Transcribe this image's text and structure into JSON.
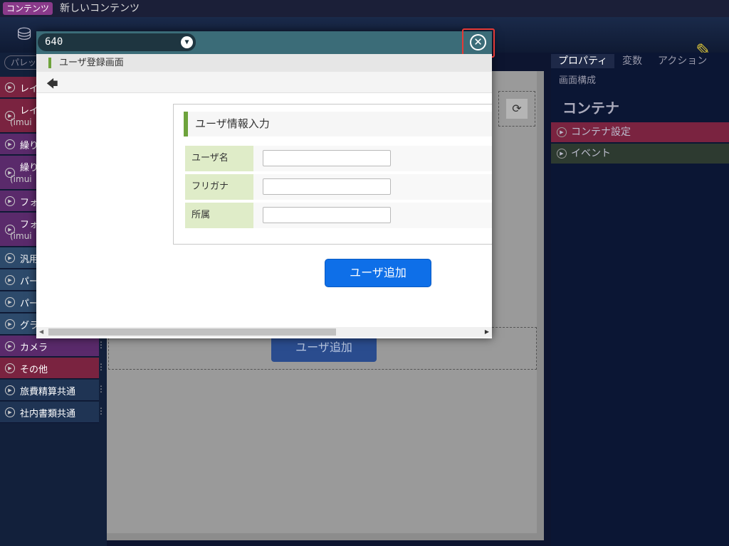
{
  "topbar": {
    "badge": "コンテンツ",
    "title": "新しいコンテンツ"
  },
  "palette": {
    "search_placeholder": "パレッ",
    "items": [
      {
        "label": "レイ",
        "sub": ""
      },
      {
        "label": "レイ",
        "sub": "(imui"
      },
      {
        "label": "繰り",
        "sub": ""
      },
      {
        "label": "繰り",
        "sub": "(imui"
      },
      {
        "label": "フォ",
        "sub": ""
      },
      {
        "label": "フォ",
        "sub": "(imui"
      },
      {
        "label": "汎用",
        "sub": ""
      },
      {
        "label": "パー",
        "sub": ""
      },
      {
        "label": "パー",
        "sub": ""
      },
      {
        "label": "グラ",
        "sub": ""
      },
      {
        "label": "カメラ",
        "sub": ""
      },
      {
        "label": "その他",
        "sub": ""
      },
      {
        "label": "旅費精算共通",
        "sub": ""
      },
      {
        "label": "社内書類共通",
        "sub": ""
      }
    ],
    "colors": [
      "#7a2340",
      "#7a2340",
      "#5a2a6b",
      "#5a2a6b",
      "#5a2a6b",
      "#5a2a6b",
      "#2d4a6b",
      "#2d4a6b",
      "#2d4a6b",
      "#2d4a6b",
      "#5a2a6b",
      "#7a2340",
      "#1f3454",
      "#1f3454"
    ]
  },
  "canvas": {
    "add_button": "ユーザ追加",
    "refresh_icon": "refresh-icon"
  },
  "right_panel": {
    "tabs": [
      "プロパティ",
      "変数",
      "アクション"
    ],
    "sub_tab": "画面構成",
    "heading": "コンテナ",
    "rows": [
      {
        "label": "コンテナ設定",
        "color": "#7a2340"
      },
      {
        "label": "イベント",
        "color": "#2d3a30"
      }
    ]
  },
  "dialog": {
    "size_value": "640",
    "screen_title": "ユーザ登録画面",
    "form": {
      "title": "ユーザ情報入力",
      "fields": [
        {
          "label": "ユーザ名",
          "value": ""
        },
        {
          "label": "フリガナ",
          "value": ""
        },
        {
          "label": "所属",
          "value": ""
        }
      ]
    },
    "add_button": "ユーザ追加"
  }
}
